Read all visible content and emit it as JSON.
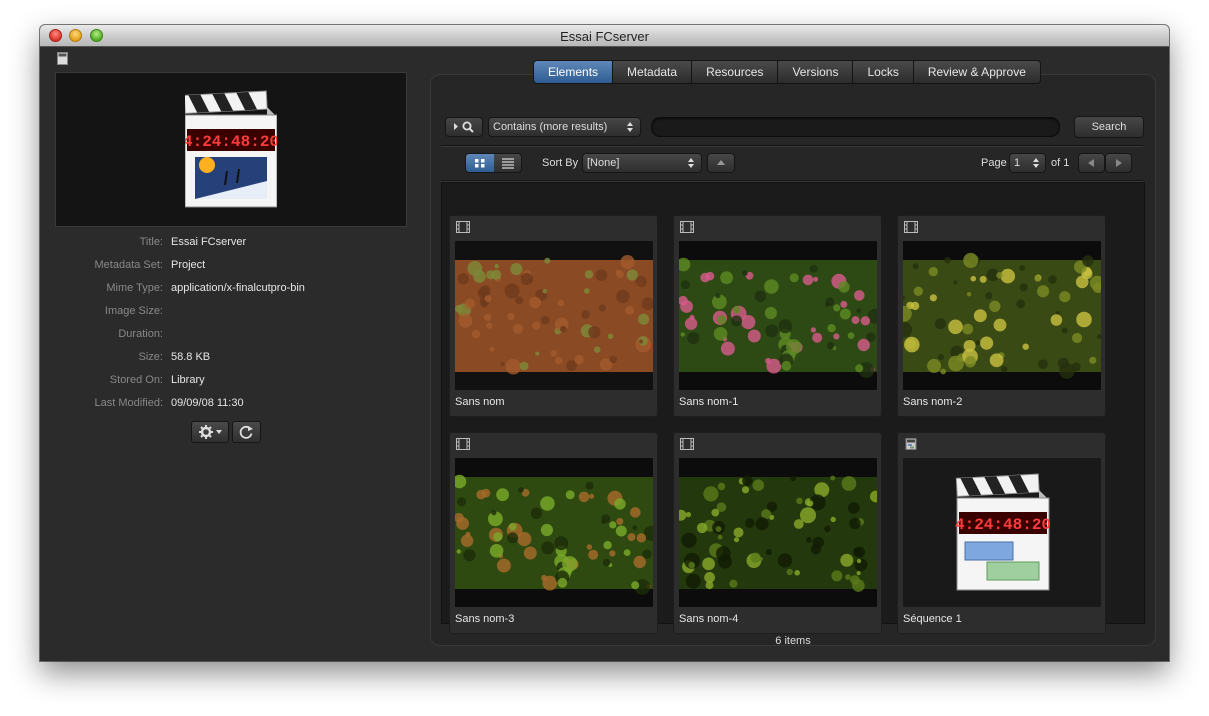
{
  "window": {
    "title": "Essai FCserver"
  },
  "metadata": [
    {
      "label": "Title:",
      "value": "Essai FCserver"
    },
    {
      "label": "Metadata Set:",
      "value": "Project"
    },
    {
      "label": "Mime Type:",
      "value": "application/x-finalcutpro-bin"
    },
    {
      "label": "Image Size:",
      "value": ""
    },
    {
      "label": "Duration:",
      "value": ""
    },
    {
      "label": "Size:",
      "value": "58.8 KB"
    },
    {
      "label": "Stored On:",
      "value": "Library"
    },
    {
      "label": "Last Modified:",
      "value": "09/09/08 11:30"
    }
  ],
  "tabs": [
    "Elements",
    "Metadata",
    "Resources",
    "Versions",
    "Locks",
    "Review & Approve"
  ],
  "active_tab": "Elements",
  "search": {
    "mode": "Contains (more results)",
    "query": "",
    "button": "Search"
  },
  "sort": {
    "label": "Sort By",
    "value": "[None]"
  },
  "paging": {
    "page_label": "Page",
    "page": "1",
    "of_label": "of 1"
  },
  "clapper_timecode": "4:24:48:20",
  "items": [
    {
      "label": "Sans nom",
      "kind": "video-clip",
      "thumb": "dirt"
    },
    {
      "label": "Sans nom-1",
      "kind": "video-clip",
      "thumb": "flowers"
    },
    {
      "label": "Sans nom-2",
      "kind": "video-clip",
      "thumb": "shrubs"
    },
    {
      "label": "Sans nom-3",
      "kind": "video-clip",
      "thumb": "foliage"
    },
    {
      "label": "Sans nom-4",
      "kind": "video-clip",
      "thumb": "grass"
    },
    {
      "label": "Séquence 1",
      "kind": "sequence",
      "thumb": "fcp-sequence-icon"
    }
  ],
  "status": {
    "count_text": "6 items"
  },
  "colors": {
    "active_tab": "#3f6ea6",
    "timecode": "#ff3b3b",
    "panel_bg": "#262626"
  }
}
